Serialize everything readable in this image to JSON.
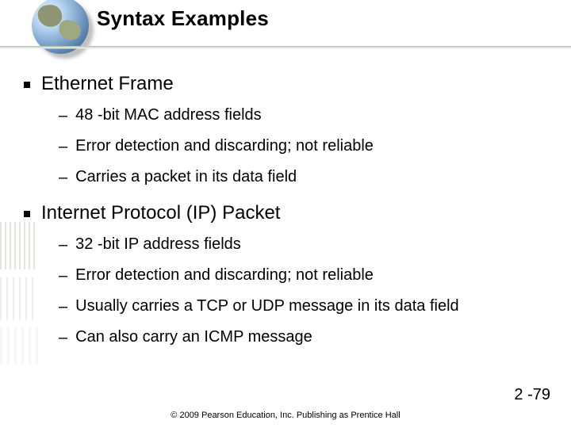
{
  "title": "Syntax Examples",
  "bullets": {
    "b1": "Ethernet Frame",
    "s1_1": "48 -bit MAC address fields",
    "s1_2": "Error detection and discarding; not reliable",
    "s1_3": "Carries a packet in its data field",
    "b2": "Internet Protocol (IP) Packet",
    "s2_1": "32 -bit IP address fields",
    "s2_2": "Error detection and discarding; not reliable",
    "s2_3": "Usually carries a TCP or UDP message in its data field",
    "s2_4": "Can also carry an ICMP message"
  },
  "dash": "–",
  "page_number": "2 -79",
  "copyright": "© 2009 Pearson Education, Inc.  Publishing as Prentice Hall"
}
